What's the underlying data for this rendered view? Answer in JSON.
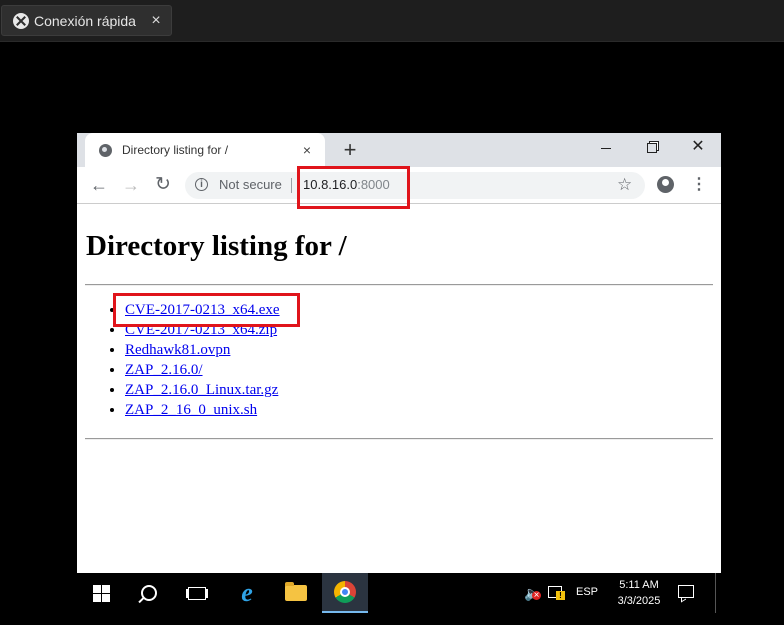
{
  "remote_desktop": {
    "tab_title": "Conexión rápida",
    "tab_close": "×"
  },
  "browser": {
    "tab_title": "Directory listing for /",
    "tab_close": "×",
    "new_tab": "+",
    "security_label": "Not secure",
    "url_host": "10.8.16.0",
    "url_port": ":8000"
  },
  "page": {
    "heading": "Directory listing for /",
    "files": [
      "CVE-2017-0213_x64.exe",
      "CVE-2017-0213_x64.zip",
      "Redhawk81.ovpn",
      "ZAP_2.16.0/",
      "ZAP_2.16.0_Linux.tar.gz",
      "ZAP_2_16_0_unix.sh"
    ]
  },
  "taskbar": {
    "apps": [
      "start-icon",
      "search-icon",
      "task-view-icon",
      "internet-explorer-icon",
      "file-explorer-icon",
      "chrome-icon"
    ],
    "active_app": "chrome-icon",
    "language": "ESP",
    "time": "5:11 AM",
    "date": "3/3/2025"
  },
  "colors": {
    "highlight": "#e0141b",
    "link": "#0000ee"
  }
}
